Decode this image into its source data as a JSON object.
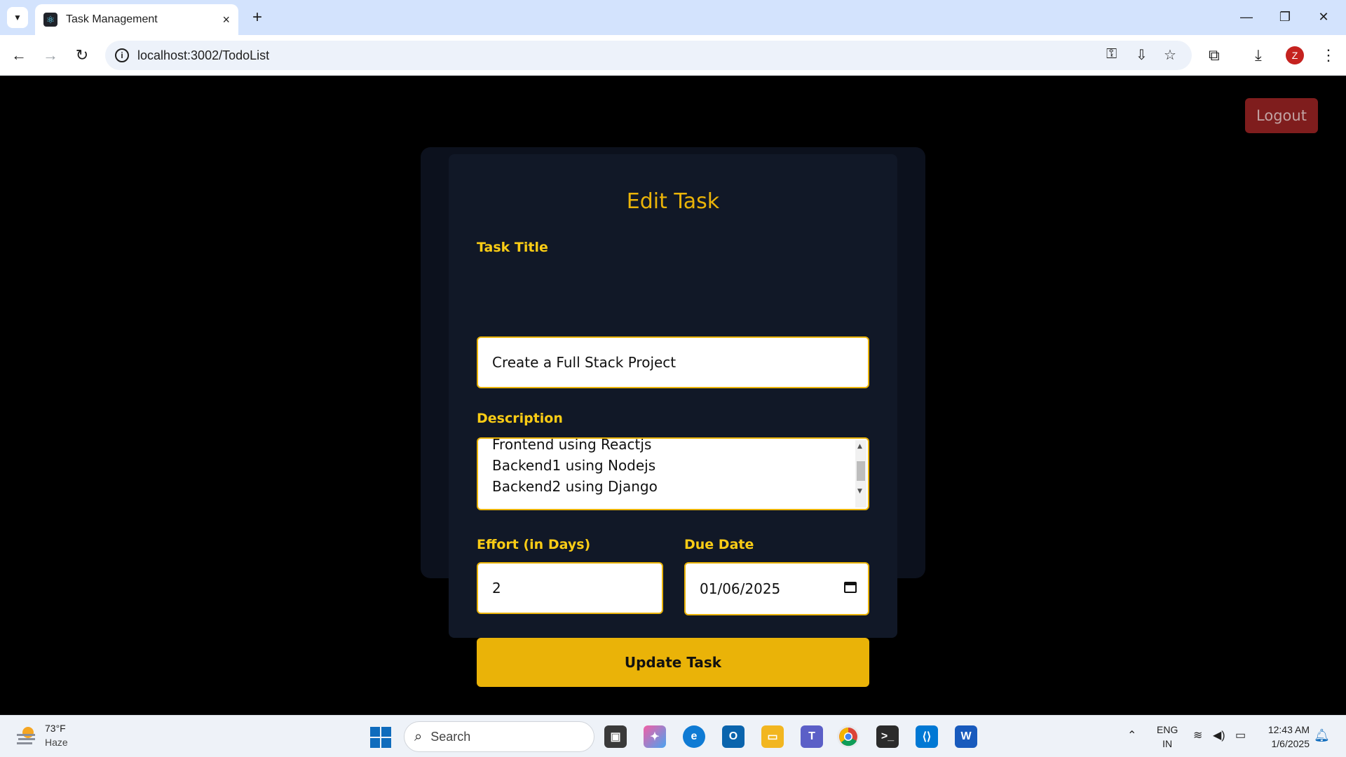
{
  "browser": {
    "tab_title": "Task Management",
    "url": "localhost:3002/TodoList",
    "new_tab_symbol": "+",
    "tab_close_symbol": "×",
    "avatar_letter": "Z"
  },
  "page": {
    "logout_label": "Logout",
    "title": "Edit Task",
    "task_title_label": "Task Title",
    "task_title_value": "Create a Full Stack Project",
    "description_label": "Description",
    "description_lines": [
      "Frontend using Reactjs",
      "Backend1 using Nodejs",
      "Backend2 using Django"
    ],
    "effort_label": "Effort (in Days)",
    "effort_value": "2",
    "due_date_label": "Due Date",
    "due_date_value": "01/06/2025",
    "update_label": "Update Task"
  },
  "taskbar": {
    "weather_temp": "73°F",
    "weather_desc": "Haze",
    "search_placeholder": "Search",
    "lang_top": "ENG",
    "lang_bottom": "IN",
    "time": "12:43 AM",
    "date": "1/6/2025"
  },
  "colors": {
    "accent": "#eab308",
    "card": "#111827",
    "logout": "#7f1d1d"
  }
}
